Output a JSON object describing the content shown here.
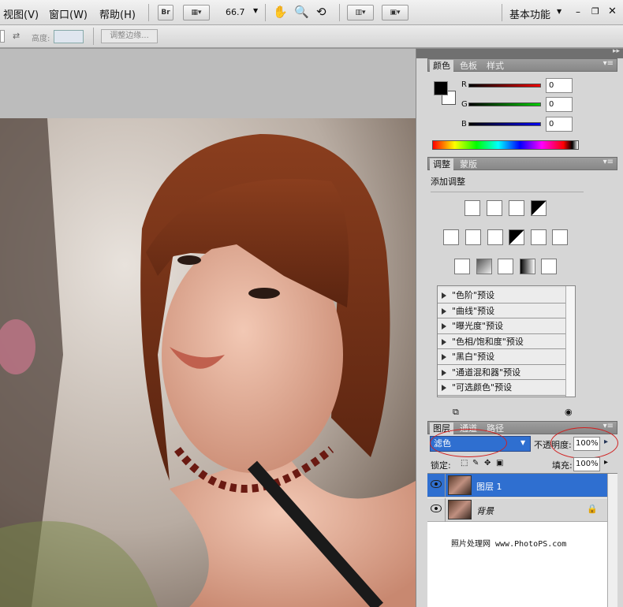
{
  "menu": {
    "view": "视图(V)",
    "window": "窗口(W)",
    "help": "帮助(H)"
  },
  "toolbar": {
    "br": "Br",
    "zoom": "66.7",
    "workspace": "基本功能"
  },
  "options": {
    "height_label": "高度:",
    "refine_edge": "调整边缘..."
  },
  "color_panel": {
    "tabs": [
      "颜色",
      "色板",
      "样式"
    ],
    "r_label": "R",
    "g_label": "G",
    "b_label": "B",
    "r": "0",
    "g": "0",
    "b": "0",
    "colors": {
      "r": "#cc0000",
      "g": "#00aa00",
      "b": "#0000cc"
    }
  },
  "adjust_panel": {
    "tabs": [
      "调整",
      "蒙版"
    ],
    "title": "添加调整",
    "presets": [
      "\"色阶\"预设",
      "\"曲线\"预设",
      "\"曝光度\"预设",
      "\"色相/饱和度\"预设",
      "\"黑白\"预设",
      "\"通道混和器\"预设",
      "\"可选颜色\"预设"
    ]
  },
  "layers_panel": {
    "tabs": [
      "图层",
      "通道",
      "路径"
    ],
    "blend_mode": "滤色",
    "opacity_label": "不透明度:",
    "opacity": "100%",
    "lock_label": "锁定:",
    "fill_label": "填充:",
    "fill": "100%",
    "layers": [
      {
        "name": "图层 1",
        "selected": true
      },
      {
        "name": "背景",
        "selected": false
      }
    ]
  },
  "watermark": "照片处理网 www.PhotoPS.com",
  "accent": "#2f6fd0"
}
